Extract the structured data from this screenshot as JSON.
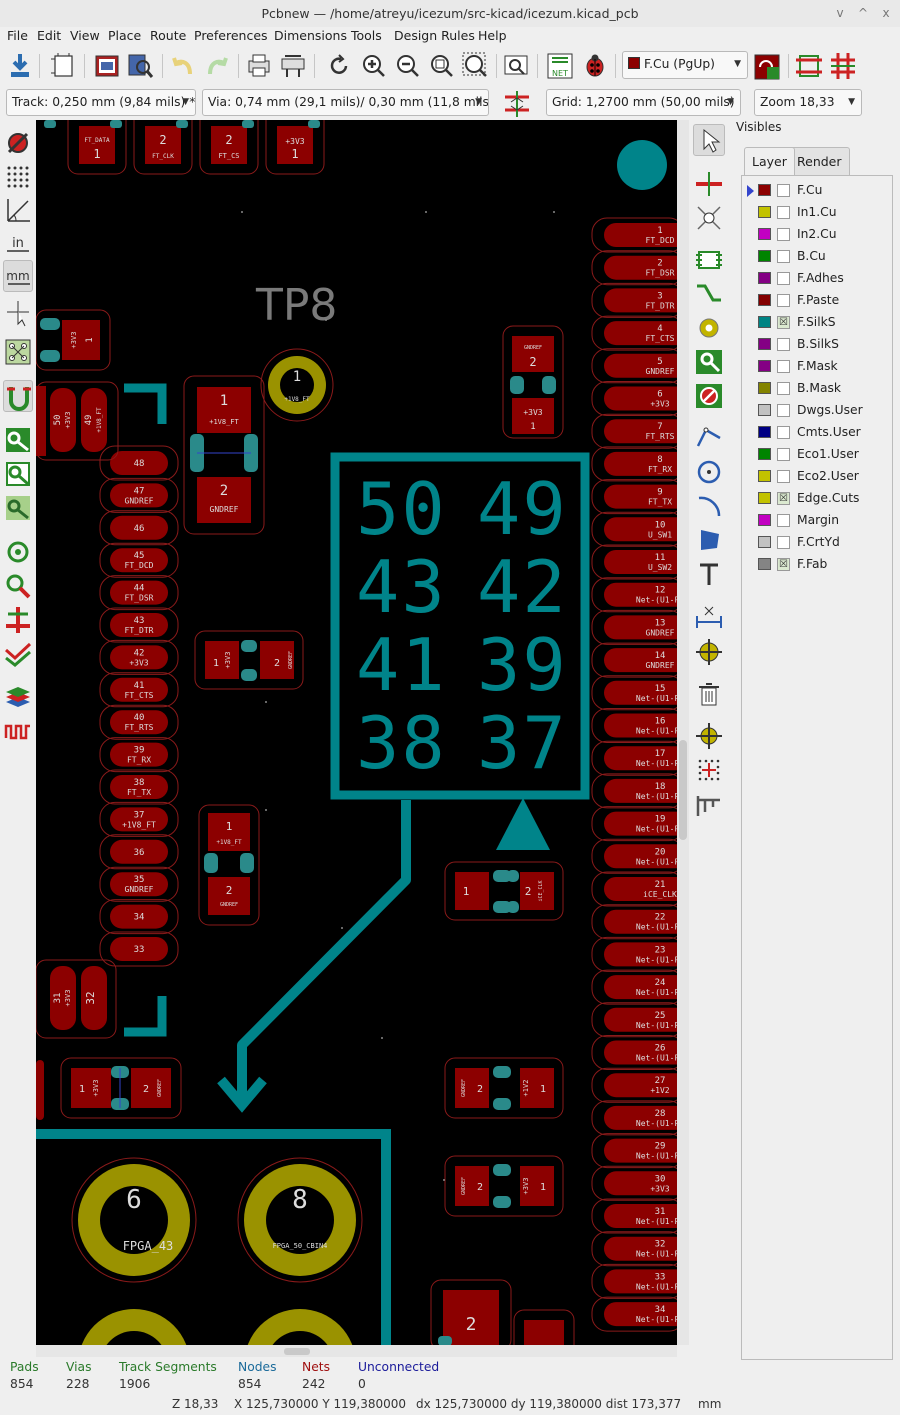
{
  "window": {
    "title": "Pcbnew — /home/atreyu/icezum/src-kicad/icezum.kicad_pcb",
    "controls": [
      "v",
      "^",
      "x"
    ]
  },
  "menu": [
    "File",
    "Edit",
    "View",
    "Place",
    "Route",
    "Preferences",
    "Dimensions",
    "Tools",
    "Design Rules",
    "Help"
  ],
  "toolbar": {
    "layer_select": "F.Cu (PgUp)",
    "net_icon_label": "NET"
  },
  "aux_toolbar": {
    "track_width": "Track: 0,250 mm (9,84 mils) *",
    "via_size": "Via: 0,74 mm (29,1 mils)/ 0,30 mm (11,8 mils) *",
    "grid": "Grid: 1,2700 mm (50,00 mils)",
    "zoom": "Zoom 18,33"
  },
  "left_toolbar": {
    "units_in_label": "in",
    "units_mm_label": "mm"
  },
  "colors": {
    "background": "#000000",
    "copper_front": "#8c0000",
    "silkscreen": "#00848a",
    "pad_ring": "#9a9200",
    "courtyard": "#8a1a1a",
    "dark_text": "#7a7a7a",
    "via_fill": "#2a8a8a"
  },
  "pcb": {
    "big_label": "TP8",
    "block_numbers": [
      "50",
      "49",
      "43",
      "42",
      "41",
      "39",
      "38",
      "37"
    ],
    "right_pins": [
      {
        "n": "1",
        "net": "FT_DCD"
      },
      {
        "n": "2",
        "net": "FT_DSR"
      },
      {
        "n": "3",
        "net": "FT_DTR"
      },
      {
        "n": "4",
        "net": "FT_CTS"
      },
      {
        "n": "5",
        "net": "GNDREF"
      },
      {
        "n": "6",
        "net": "+3V3"
      },
      {
        "n": "7",
        "net": "FT_RTS"
      },
      {
        "n": "8",
        "net": "FT_RX"
      },
      {
        "n": "9",
        "net": "FT_TX"
      },
      {
        "n": "10",
        "net": "U_SW1"
      },
      {
        "n": "11",
        "net": "U_SW2"
      },
      {
        "n": "12",
        "net": "Net-(U1-Pa"
      },
      {
        "n": "13",
        "net": "GNDREF"
      },
      {
        "n": "14",
        "net": "GNDREF"
      },
      {
        "n": "15",
        "net": "Net-(U1-Pa"
      },
      {
        "n": "16",
        "net": "Net-(U1-Pa"
      },
      {
        "n": "17",
        "net": "Net-(U1-Pa"
      },
      {
        "n": "18",
        "net": "Net-(U1-Pa"
      },
      {
        "n": "19",
        "net": "Net-(U1-Pa"
      },
      {
        "n": "20",
        "net": "Net-(U1-Pa"
      },
      {
        "n": "21",
        "net": "iCE_CLK"
      },
      {
        "n": "22",
        "net": "Net-(U1-Pa"
      },
      {
        "n": "23",
        "net": "Net-(U1-Pa"
      },
      {
        "n": "24",
        "net": "Net-(U1-Pa"
      },
      {
        "n": "25",
        "net": "Net-(U1-Pa"
      },
      {
        "n": "26",
        "net": "Net-(U1-Pa"
      },
      {
        "n": "27",
        "net": "+1V2"
      },
      {
        "n": "28",
        "net": "Net-(U1-Pa"
      },
      {
        "n": "29",
        "net": "Net-(U1-Pa"
      },
      {
        "n": "30",
        "net": "+3V3"
      },
      {
        "n": "31",
        "net": "Net-(U1-Pa"
      },
      {
        "n": "32",
        "net": "Net-(U1-Pa"
      },
      {
        "n": "33",
        "net": "Net-(U1-Pa"
      },
      {
        "n": "34",
        "net": "Net-(U1-Pa"
      }
    ],
    "left_pins": [
      {
        "n": "48",
        "net": ""
      },
      {
        "n": "47",
        "net": "GNDREF"
      },
      {
        "n": "46",
        "net": ""
      },
      {
        "n": "45",
        "net": "FT_DCD"
      },
      {
        "n": "44",
        "net": "FT_DSR"
      },
      {
        "n": "43",
        "net": "FT_DTR"
      },
      {
        "n": "42",
        "net": "+3V3"
      },
      {
        "n": "41",
        "net": "FT_CTS"
      },
      {
        "n": "40",
        "net": "FT_RTS"
      },
      {
        "n": "39",
        "net": "FT_RX"
      },
      {
        "n": "38",
        "net": "FT_TX"
      },
      {
        "n": "37",
        "net": "+1V8_FT"
      },
      {
        "n": "36",
        "net": ""
      },
      {
        "n": "35",
        "net": "GNDREF"
      },
      {
        "n": "34",
        "net": ""
      },
      {
        "n": "33",
        "net": ""
      }
    ],
    "top_pads": [
      {
        "n": "1",
        "net": "FT_DATA"
      },
      {
        "n": "2",
        "net": "FT_CLK"
      },
      {
        "n": "2",
        "net": "FT_CS"
      },
      {
        "n": "1",
        "net": "+3V3"
      }
    ],
    "tp_pad": {
      "n": "1",
      "net": "+1V8_FT"
    },
    "cap_a": {
      "p1": "1",
      "p1_net": "+1V8_FT",
      "p2": "2",
      "p2_net": "GNDREF"
    },
    "cap_b": {
      "p1": "1",
      "p1_net": "+3V3",
      "p2": "2",
      "p2_net": "GNDREF"
    },
    "cap_c": {
      "p1": "1",
      "p1_net": "+1V8_FT",
      "p2": "2",
      "p2_net": "GNDREF"
    },
    "cap_d": {
      "p1": "2",
      "p1_net": "GNDREF",
      "p2": "1",
      "p2_net": "+3V3"
    },
    "cap_e": {
      "p1": "1",
      "p2": "2",
      "p2_net": "iCE_CLK"
    },
    "cap_f": {
      "p1": "1",
      "p1_net": "+3V3",
      "p2": "2",
      "p2_net": "GNDREF"
    },
    "cap_g": {
      "p1": "2",
      "p1_net": "GNDREF",
      "p2": "1",
      "p2_net": "+1V2"
    },
    "cap_h": {
      "p1": "2",
      "p1_net": "GNDREF",
      "p2": "1",
      "p2_net": "+3V3"
    },
    "cap_left1": {
      "p1": "+3V3",
      "p2": "1"
    },
    "cap_left2": {
      "p1": "50",
      "p1_net": "+3V3",
      "p2": "49",
      "p2_net": "+1V8_FT"
    },
    "cap_left3": {
      "p1": "31",
      "p1_net": "+3V3",
      "p2": "32"
    },
    "big_pads": [
      {
        "n": "6",
        "net": "FPGA_43"
      },
      {
        "n": "8",
        "net": "FPGA_50_CBIN4"
      }
    ],
    "bottom_pad": {
      "n": "2"
    }
  },
  "visibles": {
    "title": "Visibles",
    "tabs": [
      "Layer",
      "Render"
    ],
    "layers": [
      {
        "name": "F.Cu",
        "color": "#8c0000",
        "checked": false,
        "active": true
      },
      {
        "name": "In1.Cu",
        "color": "#c2c200",
        "checked": false
      },
      {
        "name": "In2.Cu",
        "color": "#c200c2",
        "checked": false
      },
      {
        "name": "B.Cu",
        "color": "#008400",
        "checked": false
      },
      {
        "name": "F.Adhes",
        "color": "#840084",
        "checked": false
      },
      {
        "name": "F.Paste",
        "color": "#840000",
        "checked": false
      },
      {
        "name": "F.SilkS",
        "color": "#008484",
        "checked": true
      },
      {
        "name": "B.SilkS",
        "color": "#840084",
        "checked": false
      },
      {
        "name": "F.Mask",
        "color": "#840084",
        "checked": false
      },
      {
        "name": "B.Mask",
        "color": "#848400",
        "checked": false
      },
      {
        "name": "Dwgs.User",
        "color": "#c2c2c2",
        "checked": false
      },
      {
        "name": "Cmts.User",
        "color": "#000084",
        "checked": false
      },
      {
        "name": "Eco1.User",
        "color": "#008400",
        "checked": false
      },
      {
        "name": "Eco2.User",
        "color": "#c2c200",
        "checked": false
      },
      {
        "name": "Edge.Cuts",
        "color": "#c2c200",
        "checked": true
      },
      {
        "name": "Margin",
        "color": "#c200c2",
        "checked": false
      },
      {
        "name": "F.CrtYd",
        "color": "#c2c2c2",
        "checked": false
      },
      {
        "name": "F.Fab",
        "color": "#848484",
        "checked": true
      }
    ]
  },
  "message_panel": [
    {
      "label": "Pads",
      "value": "854",
      "color": "#2a7a2a"
    },
    {
      "label": "Vias",
      "value": "228",
      "color": "#2a7a2a"
    },
    {
      "label": "Track Segments",
      "value": "1906",
      "color": "#2a7a2a"
    },
    {
      "label": "Nodes",
      "value": "854",
      "color": "#1a6a9a"
    },
    {
      "label": "Nets",
      "value": "242",
      "color": "#a01010"
    },
    {
      "label": "Unconnected",
      "value": "0",
      "color": "#1a1a9a"
    }
  ],
  "statusbar": {
    "zoom": "Z 18,33",
    "xy": "X 125,730000  Y 119,380000",
    "delta": "dx 125,730000  dy 119,380000  dist 173,377",
    "units": "mm"
  }
}
